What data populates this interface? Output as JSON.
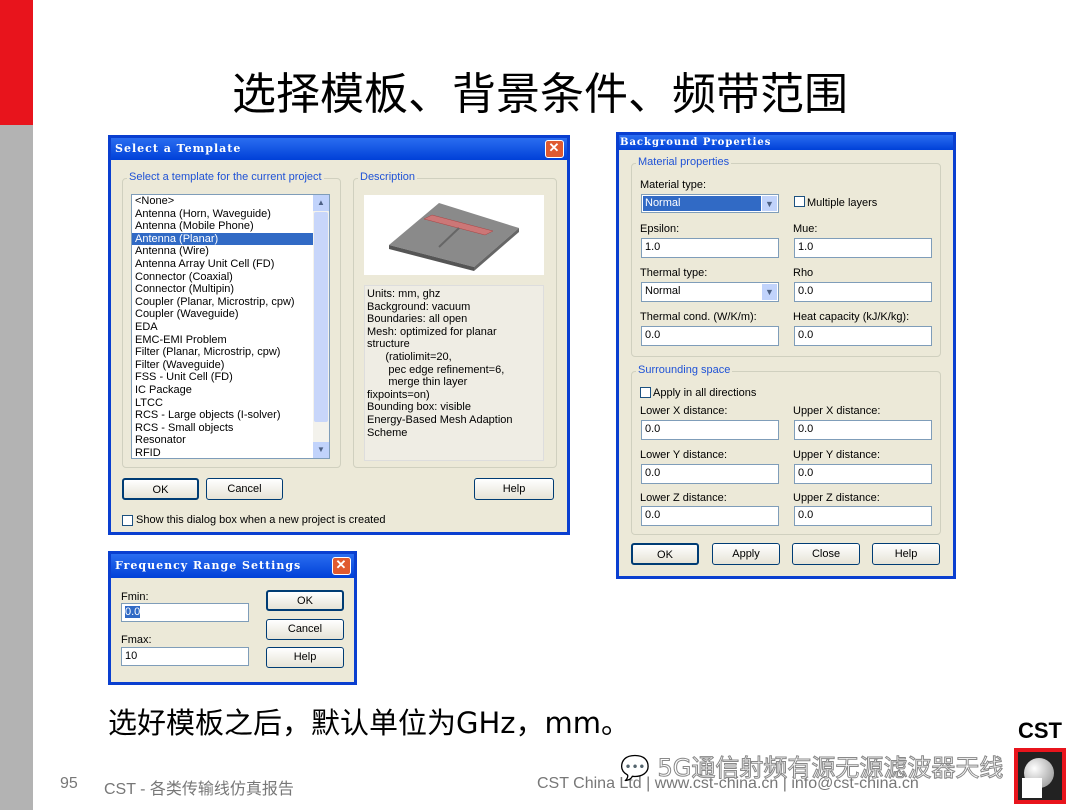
{
  "slide": {
    "title": "选择模板、背景条件、频带范围",
    "subtitle": "选好模板之后，默认单位为GHz，mm。",
    "page_number": "95",
    "footer_left": "CST - 各类传输线仿真报告",
    "footer_right": "CST China Ltd | www.cst-china.cn | info@cst-china.cn",
    "logo_text": "CST",
    "watermark": "5G通信射频有源无源滤波器天线",
    "accent_color": "#e8141c"
  },
  "template_dialog": {
    "title": "Select a Template",
    "group_label": "Select a template for the current project",
    "description_label": "Description",
    "templates": [
      "<None>",
      "Antenna (Horn, Waveguide)",
      "Antenna (Mobile Phone)",
      "Antenna (Planar)",
      "Antenna (Wire)",
      "Antenna Array Unit Cell (FD)",
      "Connector (Coaxial)",
      "Connector (Multipin)",
      "Coupler (Planar, Microstrip, cpw)",
      "Coupler (Waveguide)",
      "EDA",
      "EMC-EMI Problem",
      "Filter (Planar, Microstrip, cpw)",
      "Filter (Waveguide)",
      "FSS - Unit Cell (FD)",
      "IC Package",
      "LTCC",
      "RCS - Large objects (I-solver)",
      "RCS - Small objects",
      "Resonator",
      "RFID"
    ],
    "selected": "Antenna (Planar)",
    "description": [
      "Units: mm, ghz",
      "Background: vacuum",
      "Boundaries: all open",
      "Mesh: optimized for planar",
      "structure",
      "      (ratiolimit=20,",
      "       pec edge refinement=6,",
      "       merge thin layer",
      "fixpoints=on)",
      "Bounding box: visible",
      "Energy-Based Mesh Adaption",
      "Scheme"
    ],
    "ok": "OK",
    "cancel": "Cancel",
    "help": "Help",
    "show_checkbox": "Show this dialog box when a new project is created"
  },
  "background_dialog": {
    "title": "Background Properties",
    "material_group": "Material properties",
    "material_type_label": "Material type:",
    "material_type": "Normal",
    "multiple_layers": "Multiple layers",
    "epsilon_label": "Epsilon:",
    "epsilon": "1.0",
    "mue_label": "Mue:",
    "mue": "1.0",
    "thermal_type_label": "Thermal type:",
    "thermal_type": "Normal",
    "rho_label": "Rho",
    "rho": "0.0",
    "thermal_cond_label": "Thermal cond. (W/K/m):",
    "thermal_cond": "0.0",
    "heat_cap_label": "Heat capacity (kJ/K/kg):",
    "heat_cap": "0.0",
    "surrounding_group": "Surrounding space",
    "apply_all": "Apply in all directions",
    "lower_x_label": "Lower X distance:",
    "lower_x": "0.0",
    "upper_x_label": "Upper X distance:",
    "upper_x": "0.0",
    "lower_y_label": "Lower Y distance:",
    "lower_y": "0.0",
    "upper_y_label": "Upper Y distance:",
    "upper_y": "0.0",
    "lower_z_label": "Lower Z distance:",
    "lower_z": "0.0",
    "upper_z_label": "Upper Z distance:",
    "upper_z": "0.0",
    "ok": "OK",
    "apply": "Apply",
    "close": "Close",
    "help": "Help"
  },
  "frequency_dialog": {
    "title": "Frequency Range Settings",
    "fmin_label": "Fmin:",
    "fmin": "0.0",
    "fmax_label": "Fmax:",
    "fmax": "10",
    "ok": "OK",
    "cancel": "Cancel",
    "help": "Help"
  }
}
